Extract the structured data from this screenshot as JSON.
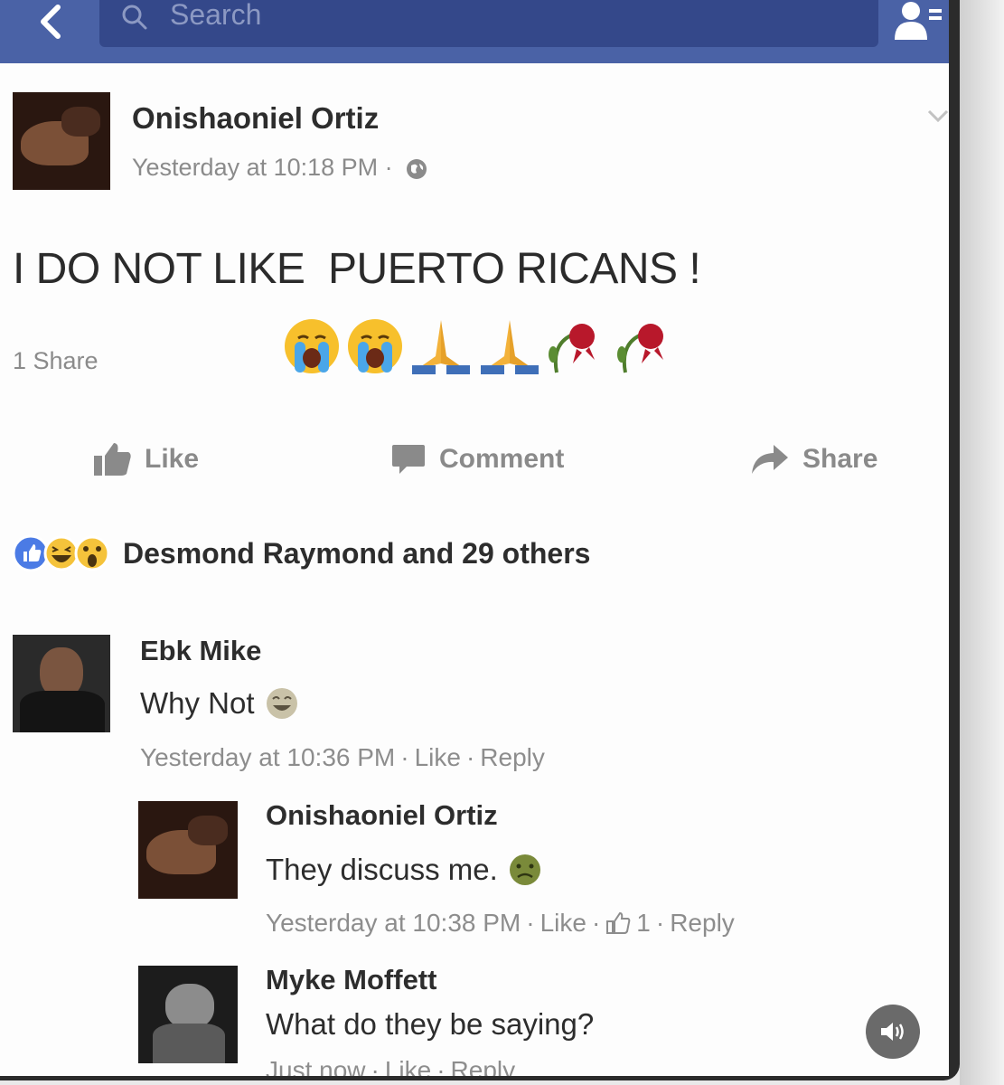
{
  "topbar": {
    "search_placeholder": "Search"
  },
  "post": {
    "author": "Onishaoniel Ortiz",
    "timestamp": "Yesterday at 10:18 PM · ",
    "text": "I DO NOT LIKE  PUERTO RICANS !",
    "emojis": [
      "loudly-crying-face",
      "loudly-crying-face",
      "folded-hands",
      "folded-hands",
      "wilted-flower",
      "wilted-flower"
    ],
    "share_count": "1 Share",
    "actions": {
      "like": "Like",
      "comment": "Comment",
      "share": "Share"
    },
    "reactions": {
      "icons": [
        "like-reaction",
        "haha-reaction",
        "wow-reaction"
      ],
      "summary": "Desmond Raymond and 29 others"
    }
  },
  "comments": [
    {
      "author": "Ebk Mike",
      "text": "Why Not",
      "emoji": "laughing-crying-face",
      "time": "Yesterday at 10:36 PM",
      "like": "Like",
      "reply": "Reply"
    },
    {
      "author": "Onishaoniel Ortiz",
      "text": "They discuss me.",
      "emoji": "nauseated-face",
      "time": "Yesterday at 10:38 PM",
      "like": "Like",
      "like_count": "1",
      "reply": "Reply"
    },
    {
      "author": "Myke Moffett",
      "text": "What do they be saying?",
      "time": "Just now",
      "like": "Like",
      "reply": "Reply"
    }
  ],
  "colors": {
    "topbar": "#4a62a6",
    "search_box": "#34488a",
    "text_dark": "#2d2d2d",
    "text_muted": "#8b8b8b"
  }
}
